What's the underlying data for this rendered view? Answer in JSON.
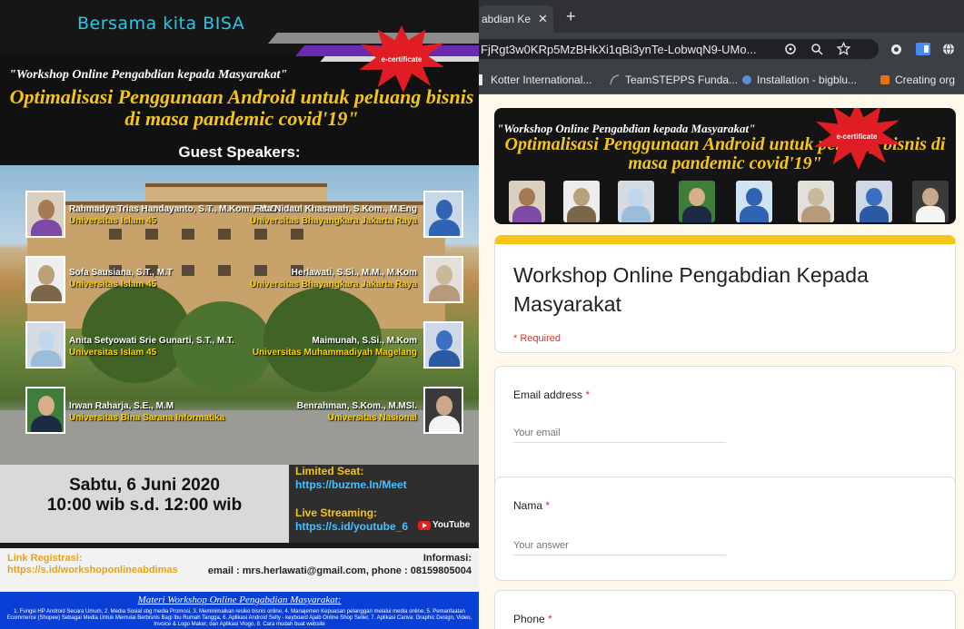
{
  "poster": {
    "motto": "Bersama kita BISA",
    "certificate": "e-certificate",
    "workshop": "\"Workshop Online Pengabdian kepada Masyarakat\"",
    "title": "Optimalisasi Penggunaan Android untuk peluang bisnis di masa pandemic covid'19\"",
    "guest_speakers": "Guest Speakers:",
    "speakers": [
      {
        "name": "Rahmadya Trias Handayanto, S.T., M.Kom., Ph.D",
        "uni": "Universitas Islam 45"
      },
      {
        "name": "Fata Nidaul Khasanah, S.Kom., M.Eng",
        "uni": "Universitas Bhayangkara Jakarta Raya"
      },
      {
        "name": "Sofa Sausiana, S.T., M.T",
        "uni": "Universitas Islam 45"
      },
      {
        "name": "Herlawati, S.Si., M.M., M.Kom",
        "uni": "Universitas Bhayangkara Jakarta Raya"
      },
      {
        "name": "Anita Setyowati Srie Gunarti, S.T., M.T.",
        "uni": "Universitas Islam 45"
      },
      {
        "name": "Maimunah, S.Si., M.Kom",
        "uni": "Universitas Muhammadiyah Magelang"
      },
      {
        "name": "Irwan Raharja, S.E., M.M",
        "uni": "Universitas Bina Sarana Informatika"
      },
      {
        "name": "Benrahman, S.Kom., M.MSI.",
        "uni": "Universitas Nasional"
      }
    ],
    "date": "Sabtu, 6 Juni 2020",
    "time": "10:00 wib s.d. 12:00 wib",
    "limited_seat": "Limited Seat:",
    "limited_seat_url": "https://buzme.In/Meet",
    "live_streaming": "Live Streaming:",
    "live_streaming_url": "https://s.id/youtube_6",
    "youtube": "YouTube",
    "link_reg_label": "Link Registrasi:",
    "link_reg_url": "https://s.id/workshoponlineabdimas",
    "informasi": "Informasi:",
    "contact": "email : mrs.herlawati@gmail.com, phone : 08159805004",
    "materi_title": "Materi Workshop Online Pengabdian Masyarakat:",
    "materi_text": "1. Fungsi HP Android Secara Umum, 2. Media Sosial sbg media Promosi, 3. Meminimalkan resiko bisnis online, 4. Manajemen Kepuasan pelanggan melalui media online, 5. Pemanfaatan Ecommerce (Shopee) Sebagai Media Untuk Memulai Berbisnis Bagi Ibu Rumah Tangga, 6. Aplikasi Android Selly - keyboard Ajaib Online Shop Seller, 7. Aplikasi Canva: Graphic Design, Video, Invoice & Logo Maker, dan Aplikasi Vlogo, 8. Cara mudah buat website"
  },
  "browser": {
    "tab_title": "abdian Ke",
    "tab_close": "✕",
    "new_tab": "+",
    "url": "FjRgt3w0KRp5MzBHkXi1qBi3ynTe-LobwqN9-UMo...",
    "bookmarks": [
      {
        "label": "Kotter International...",
        "color": "#7a7a7a"
      },
      {
        "label": "TeamSTEPPS Funda...",
        "color": "#9aa0a6"
      },
      {
        "label": "Installation - bigblu...",
        "color": "#5f8fd6"
      },
      {
        "label": "Creating org",
        "color": "#e8710a"
      }
    ]
  },
  "form": {
    "banner_workshop": "\"Workshop Online Pengabdian kepada Masyarakat\"",
    "banner_title": "Optimalisasi Penggunaan Android untuk peluang bisnis di masa pandemic covid'19\"",
    "banner_certificate": "e-certificate",
    "title": "Workshop Online Pengabdian Kepada Masyarakat",
    "required_note": "* Required",
    "questions": [
      {
        "label": "Email address",
        "placeholder": "Your email"
      },
      {
        "label": "Nama",
        "placeholder": "Your answer"
      },
      {
        "label": "Phone",
        "placeholder": ""
      }
    ],
    "required_mark": "*"
  },
  "colors": {
    "accent_yellow": "#f5c518",
    "required_red": "#d93025",
    "page_bg": "#fdf8ea"
  }
}
